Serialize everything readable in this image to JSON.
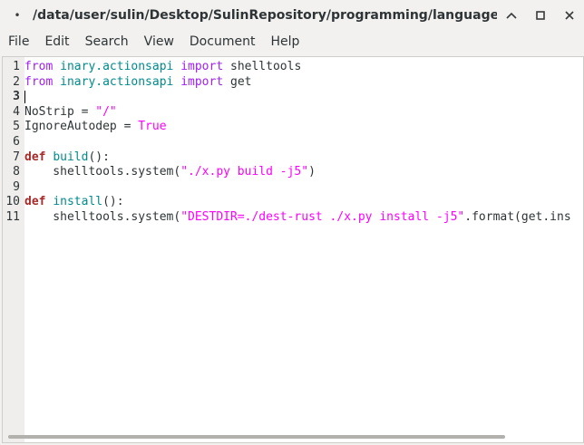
{
  "window": {
    "title": "/data/user/sulin/Desktop/SulinRepository/programming/language/rust",
    "modified_marker": "•",
    "controls": {
      "minimize": "^",
      "maximize": "□",
      "close": "✕"
    }
  },
  "menu": {
    "items": [
      "File",
      "Edit",
      "Search",
      "View",
      "Document",
      "Help"
    ]
  },
  "editor": {
    "current_line": 3,
    "lines": [
      {
        "n": "1",
        "parts": [
          [
            "kw-imp",
            "from"
          ],
          [
            "",
            " "
          ],
          [
            "mod",
            "inary.actionsapi"
          ],
          [
            "",
            " "
          ],
          [
            "kw-imp",
            "import"
          ],
          [
            "",
            " shelltools"
          ]
        ]
      },
      {
        "n": "2",
        "parts": [
          [
            "kw-imp",
            "from"
          ],
          [
            "",
            " "
          ],
          [
            "mod",
            "inary.actionsapi"
          ],
          [
            "",
            " "
          ],
          [
            "kw-imp",
            "import"
          ],
          [
            "",
            " get"
          ]
        ]
      },
      {
        "n": "3",
        "parts": []
      },
      {
        "n": "4",
        "parts": [
          [
            "",
            "NoStrip = "
          ],
          [
            "str",
            "\"/\""
          ]
        ]
      },
      {
        "n": "5",
        "parts": [
          [
            "",
            "IgnoreAutodep = "
          ],
          [
            "bool",
            "True"
          ]
        ]
      },
      {
        "n": "6",
        "parts": []
      },
      {
        "n": "7",
        "parts": [
          [
            "kw-def",
            "def"
          ],
          [
            "",
            " "
          ],
          [
            "fn",
            "build"
          ],
          [
            "",
            "():"
          ]
        ]
      },
      {
        "n": "8",
        "parts": [
          [
            "",
            "    shelltools.system("
          ],
          [
            "str",
            "\"./x.py build -j5\""
          ],
          [
            "",
            ")"
          ]
        ]
      },
      {
        "n": "9",
        "parts": []
      },
      {
        "n": "10",
        "parts": [
          [
            "kw-def",
            "def"
          ],
          [
            "",
            " "
          ],
          [
            "fn",
            "install"
          ],
          [
            "",
            "():"
          ]
        ]
      },
      {
        "n": "11",
        "parts": [
          [
            "",
            "    shelltools.system("
          ],
          [
            "str",
            "\"DESTDIR=./dest-rust ./x.py install -j5\""
          ],
          [
            "",
            ".format(get.ins"
          ]
        ]
      }
    ]
  }
}
